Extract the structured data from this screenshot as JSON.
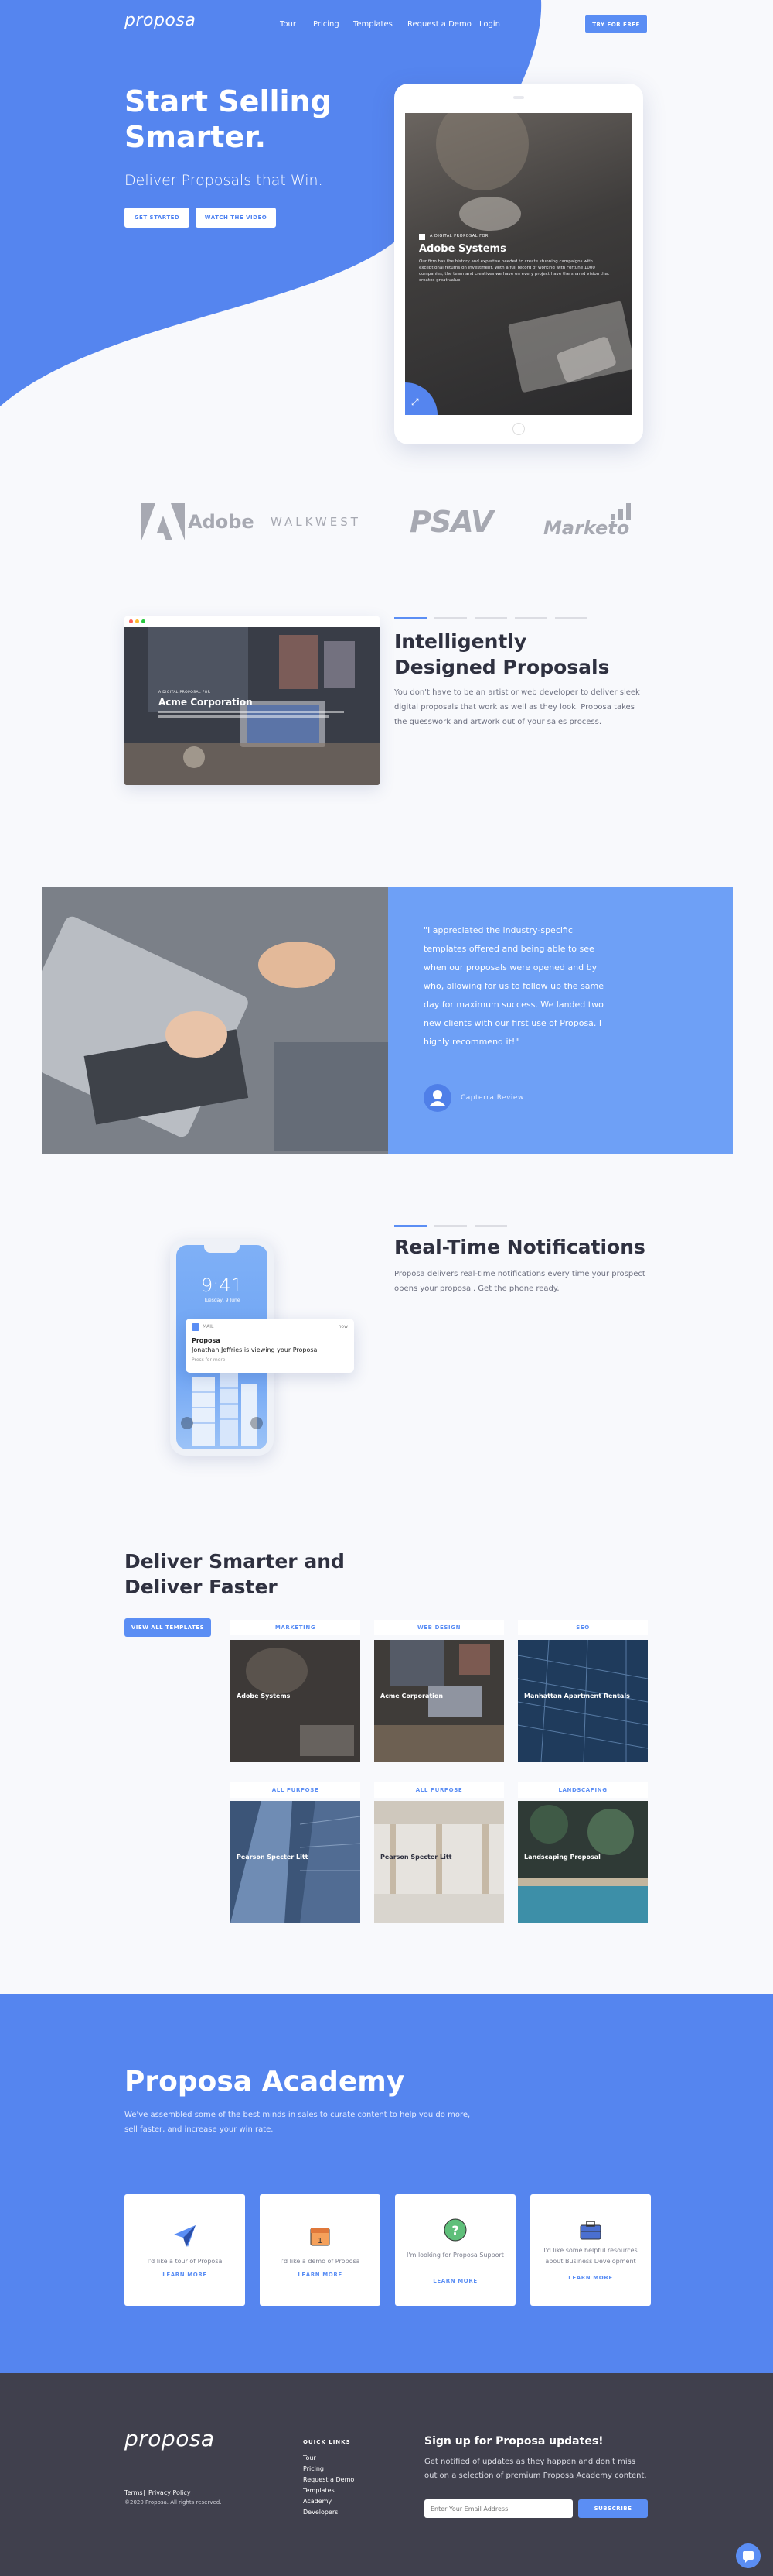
{
  "nav": {
    "logo": "proposa",
    "items": [
      "Tour",
      "Pricing",
      "Templates",
      "Request a Demo",
      "Login"
    ],
    "cta": "Try for free"
  },
  "hero": {
    "title": "Start Selling Smarter.",
    "subtitle": "Deliver Proposals that Win.",
    "btn_primary": "Get Started",
    "btn_secondary": "Watch the Video",
    "tablet": {
      "kicker": "A DIGITAL PROPOSAL FOR",
      "company": "Adobe Systems",
      "body": "Our firm has the history and expertise needed to create stunning campaigns with exceptional returns on investment. With a full record of working with Fortune 1000 companies, the team and creatives we have on every project have the shared vision that creates great value."
    }
  },
  "brands": [
    "Adobe",
    "WALKWEST",
    "PSAV",
    "Marketo"
  ],
  "feature1": {
    "title": "Intelligently Designed Proposals",
    "text": "You don't have to be an artist or web developer to deliver sleek digital proposals that work as well as they look. Proposa takes the guesswork and artwork out of your sales process.",
    "preview_company": "Acme Corporation",
    "preview_kicker": "A DIGITAL PROPOSAL FOR"
  },
  "testimonial": {
    "quote": "\"I appreciated the industry-specific templates offered and being able to see when our proposals were opened and by who, allowing for us to follow up the same day for maximum success. We landed two new clients with our first use of Proposa. I highly recommend it!\"",
    "source": "Capterra Review"
  },
  "feature2": {
    "title": "Real-Time Notifications",
    "text": "Proposa delivers real-time notifications every time your prospect opens your proposal. Get the phone ready.",
    "phone_time": "9:41",
    "phone_date": "Tuesday, 9 June",
    "notif_app": "MAIL",
    "notif_time": "now",
    "notif_title": "Proposa",
    "notif_body": "Jonathan Jeffries is viewing your Proposal",
    "notif_hint": "Press for more"
  },
  "templates": {
    "title": "Deliver Smarter and Deliver Faster",
    "button": "View All Templates",
    "items": [
      {
        "category": "MARKETING",
        "name": "Adobe Systems"
      },
      {
        "category": "WEB DESIGN",
        "name": "Acme Corporation"
      },
      {
        "category": "SEO",
        "name": "Manhattan Apartment Rentals"
      },
      {
        "category": "ALL PURPOSE",
        "name": "Pearson Specter Litt"
      },
      {
        "category": "ALL PURPOSE",
        "name": "Pearson Specter Litt"
      },
      {
        "category": "LANDSCAPING",
        "name": "Landscaping Proposal"
      }
    ]
  },
  "academy": {
    "title": "Proposa Academy",
    "text": "We've assembled some of the best minds in sales to curate content to help you do more, sell faster, and increase your win rate.",
    "cards": [
      {
        "text": "I'd like a tour of Proposa",
        "link": "LEARN MORE",
        "icon": "paper-plane-icon"
      },
      {
        "text": "I'd like a demo of Proposa",
        "link": "LEARN MORE",
        "icon": "calendar-icon"
      },
      {
        "text": "I'm looking for Proposa Support",
        "link": "LEARN MORE",
        "icon": "question-icon"
      },
      {
        "text": "I'd like some helpful resources about Business Development",
        "link": "LEARN MORE",
        "icon": "briefcase-icon"
      }
    ]
  },
  "footer": {
    "logo": "proposa",
    "legal_links": [
      "Terms",
      "Privacy Policy"
    ],
    "copyright": "©2020 Proposa. All rights reserved.",
    "quick_links_title": "QUICK LINKS",
    "quick_links": [
      "Tour",
      "Pricing",
      "Request a Demo",
      "Templates",
      "Academy",
      "Developers"
    ],
    "signup_title": "Sign up for Proposa updates!",
    "signup_text": "Get notified of updates as they happen and don't miss out on a selection of premium Proposa Academy content.",
    "email_placeholder": "Enter Your Email Address",
    "subscribe": "SUBSCRIBE"
  },
  "colors": {
    "primary": "#5585ef",
    "dark": "#40404d",
    "accent": "#4f83f1"
  }
}
